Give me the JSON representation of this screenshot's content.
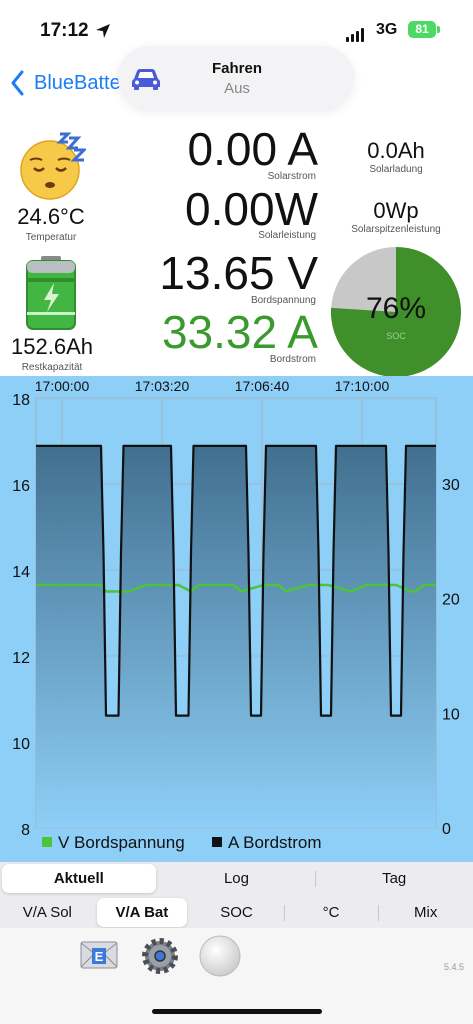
{
  "status": {
    "time": "17:12",
    "network": "3G",
    "battery": "81"
  },
  "nav": {
    "back_label": "BlueBatte",
    "mode_title": "Fahren",
    "mode_sub": "Aus"
  },
  "left": {
    "temperature": "24.6°C",
    "temperature_label": "Temperatur",
    "capacity": "152.6Ah",
    "capacity_label": "Restkapazität"
  },
  "center": {
    "solar_current": "0.00 A",
    "solar_current_label": "Solarstrom",
    "solar_power": "0.00W",
    "solar_power_label": "Solarleistung",
    "voltage": "13.65 V",
    "voltage_label": "Bordspannung",
    "current": "33.32 A",
    "current_label": "Bordstrom"
  },
  "right": {
    "solar_charge": "0.0Ah",
    "solar_charge_label": "Solarladung",
    "solar_peak": "0Wp",
    "solar_peak_label": "Solarspitzenleistung",
    "soc_text": "76%",
    "soc_label": "SOC",
    "soc_value": 76
  },
  "colors": {
    "accent": "#1b7cf6",
    "green": "#3a9a2e",
    "pie_green": "#3f8f2a",
    "pie_gray": "#c8c8c8",
    "chart_bg": "#8ecff7"
  },
  "chart_data": {
    "type": "line",
    "x_ticks": [
      "17:00:00",
      "17:03:20",
      "17:06:40",
      "17:10:00"
    ],
    "y_left_ticks": [
      "18",
      "16",
      "14",
      "12",
      "10",
      "8"
    ],
    "y_left_range": [
      8,
      18
    ],
    "y_right_ticks": [
      "30",
      "20",
      "10",
      "0"
    ],
    "y_right_range": [
      0,
      37.5
    ],
    "series": [
      {
        "name": "V Bordspannung",
        "axis": "left",
        "color": "#4cc43a",
        "x_sec": [
          0,
          130,
          140,
          185,
          220,
          235,
          285,
          310,
          325,
          370,
          395,
          410,
          455,
          485,
          500,
          545,
          570,
          585,
          630,
          660,
          675,
          720,
          750,
          760,
          775,
          800
        ],
        "values": [
          13.65,
          13.65,
          13.5,
          13.5,
          13.65,
          13.65,
          13.65,
          13.5,
          13.65,
          13.65,
          13.65,
          13.5,
          13.65,
          13.65,
          13.5,
          13.65,
          13.65,
          13.65,
          13.5,
          13.65,
          13.65,
          13.65,
          13.5,
          13.5,
          13.65,
          13.65
        ]
      },
      {
        "name": "A Bordstrom",
        "axis": "right",
        "color": "#111111",
        "x_sec": [
          0,
          130,
          135,
          140,
          165,
          170,
          175,
          270,
          275,
          280,
          305,
          310,
          315,
          420,
          425,
          430,
          450,
          455,
          460,
          560,
          565,
          570,
          590,
          595,
          600,
          700,
          705,
          710,
          730,
          735,
          740,
          800
        ],
        "values": [
          33.32,
          33.32,
          24,
          9.8,
          9.8,
          24,
          33.32,
          33.32,
          24,
          9.8,
          9.8,
          24,
          33.32,
          33.32,
          24,
          9.8,
          9.8,
          24,
          33.32,
          33.32,
          24,
          9.8,
          9.8,
          24,
          33.32,
          33.32,
          24,
          9.8,
          9.8,
          24,
          33.32,
          33.32
        ]
      }
    ],
    "legend": "bottom"
  },
  "tabs_top": [
    "Aktuell",
    "Log",
    "Tag"
  ],
  "tabs_top_selected": 0,
  "tabs_bottom": [
    "V/A Sol",
    "V/A Bat",
    "SOC",
    "°C",
    "Mix"
  ],
  "tabs_bottom_selected": 1,
  "toolbar": {
    "mail_letter": "E"
  },
  "version": "5.4.5"
}
